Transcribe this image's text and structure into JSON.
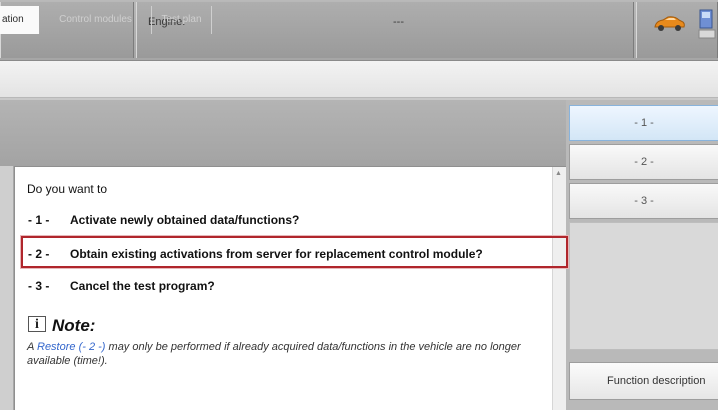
{
  "header": {
    "engine_label": "Engine:",
    "engine_value": "---"
  },
  "tabs": {
    "operation": "ation",
    "control_modules": "Control modules",
    "test_plan": "Test plan"
  },
  "dialog": {
    "question": "Do you want to",
    "options": [
      {
        "num": "- 1 -",
        "text": "Activate newly obtained data/functions?"
      },
      {
        "num": "- 2 -",
        "text": "Obtain existing activations from server for replacement control module?"
      },
      {
        "num": "- 3 -",
        "text": "Cancel the test program?"
      }
    ],
    "note_icon": "i",
    "note_title": "Note:",
    "note_prefix": "A ",
    "note_link": "Restore (- 2 -)",
    "note_suffix": " may only be performed if already acquired data/functions in the vehicle are no longer available (time!)."
  },
  "right_buttons": {
    "b1": "- 1 -",
    "b2": "- 2 -",
    "b3": "- 3 -",
    "function_description": "Function description"
  },
  "icons": {
    "car": "car-icon",
    "dealer": "dealer-icon"
  },
  "colors": {
    "highlight": "#b0262c",
    "link": "#3366cc",
    "selected_button": "#d3e6f6"
  }
}
